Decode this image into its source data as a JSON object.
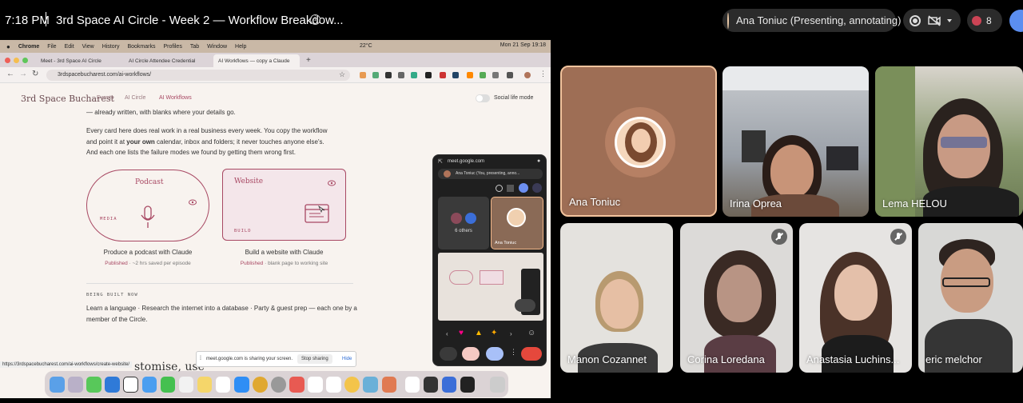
{
  "meet": {
    "time": "7:18 PM",
    "title": "3rd Space AI Circle - Week 2 — Workflow Breakdow...",
    "presenter_pill": "Ana Toniuc (Presenting, annotating)",
    "participants_count": "8"
  },
  "mac": {
    "menu": [
      "Chrome",
      "File",
      "Edit",
      "View",
      "History",
      "Bookmarks",
      "Profiles",
      "Tab",
      "Window",
      "Help"
    ],
    "temp": "22°C",
    "datetime": "Mon 21 Sep  19:18"
  },
  "browser": {
    "tabs": [
      "Meet - 3rd Space AI Circle",
      "AI Circle Attendee Credential",
      "AI Workflows — copy a Claude"
    ],
    "url": "3rdspacebucharest.com/ai-workflows/"
  },
  "site": {
    "logo": "3rd Space Bucharest",
    "nav": [
      "Events",
      "AI Circle",
      "AI Workflows"
    ],
    "toggle_label": "Social life mode",
    "para0": "— already written, with blanks where your details go.",
    "para1_l1": "Every card here does real work in a real business every week. You copy the workflow",
    "para1_l2a": "and point it at ",
    "para1_l2b": "your own",
    "para1_l2c": " calendar, inbox and folders; it never touches anyone else's.",
    "para1_l3": "And each one lists the failure modes we found by getting them wrong first.",
    "cards": [
      {
        "title": "Podcast",
        "tag": "MEDIA",
        "caption": "Produce a podcast with Claude",
        "status": "Published",
        "detail": " · ~2 hrs saved per episode"
      },
      {
        "title": "Website",
        "tag": "BUILD",
        "caption": "Build a website with Claude",
        "status": "Published",
        "detail": " · blank page to working site"
      }
    ],
    "built_heading": "BEING BUILT NOW",
    "built_l1": "Learn a language · Research the internet into a database · Party & guest prep — each one by a",
    "built_l2": "member of the Circle.",
    "bottom_text": "stomise, use",
    "status_url": "https://3rdspacebucharest.com/ai-workflows/create-website/",
    "share_text": "meet.google.com is sharing your screen.",
    "stop_sharing": "Stop sharing",
    "hide": "Hide"
  },
  "pip": {
    "url": "meet.google.com",
    "presenter": "Ana Toniuc (You, presenting, anno...",
    "others": "6 others",
    "ana": "Ana Toniuc"
  },
  "participants": [
    "Ana Toniuc",
    "Irina Oprea",
    "Lema HELOU",
    "Manon Cozannet",
    "Corina Loredana",
    "Anastasia Luchins...",
    "eric melchor"
  ]
}
